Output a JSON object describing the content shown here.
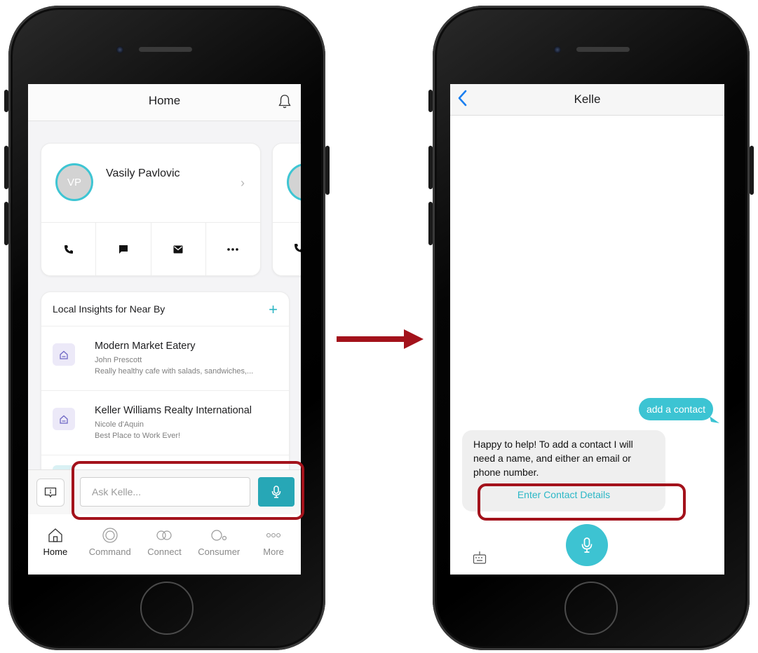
{
  "home_screen": {
    "header": {
      "title": "Home"
    },
    "contact_card": {
      "initials": "VP",
      "name": "Vasily Pavlovic",
      "actions": [
        "call-icon",
        "message-icon",
        "email-icon",
        "more-icon"
      ]
    },
    "insights": {
      "heading": "Local Insights for Near By",
      "add_label": "+",
      "items": [
        {
          "title": "Modern Market Eatery",
          "author": "John Prescott",
          "description": "Really healthy cafe with salads, sandwiches,..."
        },
        {
          "title": "Keller Williams Realty International",
          "author": "Nicole d'Aquin",
          "description": "Best Place to Work Ever!"
        }
      ]
    },
    "ask_bar": {
      "placeholder": "Ask Kelle..."
    },
    "tabs": [
      {
        "label": "Home",
        "icon": "home-icon",
        "active": true
      },
      {
        "label": "Command",
        "icon": "command-icon",
        "active": false
      },
      {
        "label": "Connect",
        "icon": "connect-icon",
        "active": false
      },
      {
        "label": "Consumer",
        "icon": "consumer-icon",
        "active": false
      },
      {
        "label": "More",
        "icon": "more-dots-icon",
        "active": false
      }
    ]
  },
  "chat_screen": {
    "header": {
      "title": "Kelle"
    },
    "user_message": "add a contact",
    "bot_message": "Happy to help! To add a contact I will need a name, and either an email or phone number.",
    "bot_action": "Enter Contact Details"
  },
  "colors": {
    "accent": "#3cc4d3",
    "highlight": "#a3121b"
  }
}
